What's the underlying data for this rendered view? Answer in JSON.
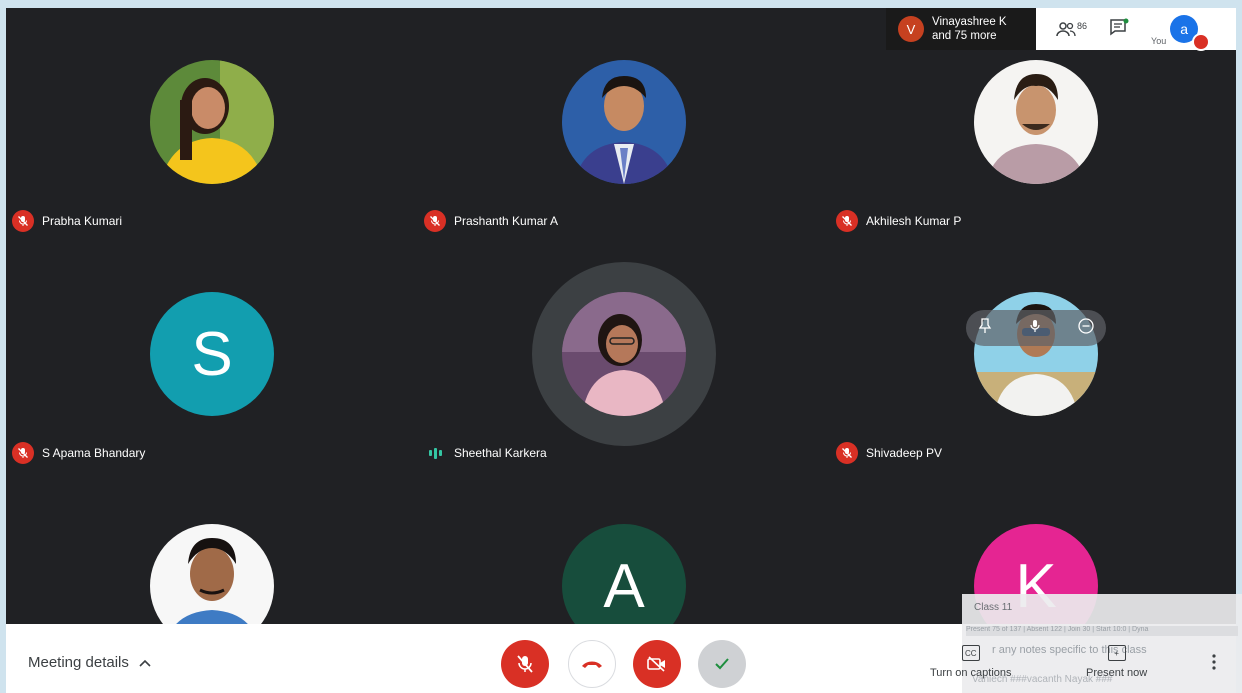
{
  "participants": [
    {
      "name": "Prabha Kumari",
      "mic": "off"
    },
    {
      "name": "Prashanth Kumar A",
      "mic": "off"
    },
    {
      "name": "Akhilesh Kumar P",
      "mic": "off"
    },
    {
      "name": "S Apama Bhandary",
      "mic": "off",
      "initial": "S"
    },
    {
      "name": "Sheethal Karkera",
      "mic": "speaking"
    },
    {
      "name": "Shivadeep PV",
      "mic": "off"
    },
    {
      "name": "",
      "mic": "off"
    },
    {
      "name": "",
      "mic": "off",
      "initial": "A"
    },
    {
      "name": "",
      "mic": "off",
      "initial": "K"
    }
  ],
  "header": {
    "presenter_initial": "V",
    "presenter_line1": "Vinayashree K",
    "presenter_line2": "and 75 more",
    "people_count": "86",
    "you_label": "You",
    "my_initial": "a"
  },
  "bottom": {
    "meeting_details": "Meeting details",
    "captions_label": "Turn on captions",
    "captions_icon": "CC",
    "present_label": "Present now"
  },
  "notes_overlay": {
    "class_label": "Class 11",
    "stats": "Present 75 of 137 | Absent 122 | Join 30 | Start 10:0 | Dyna",
    "hint": "r any notes specific to this class",
    "footer": "Vaniech ###vacanth Nayak ###"
  },
  "colors": {
    "mic_off": "#d93025",
    "speaking": "#34c6a3",
    "letter_S": "#129eaf",
    "letter_A": "#174d3c",
    "letter_K": "#e52592"
  }
}
